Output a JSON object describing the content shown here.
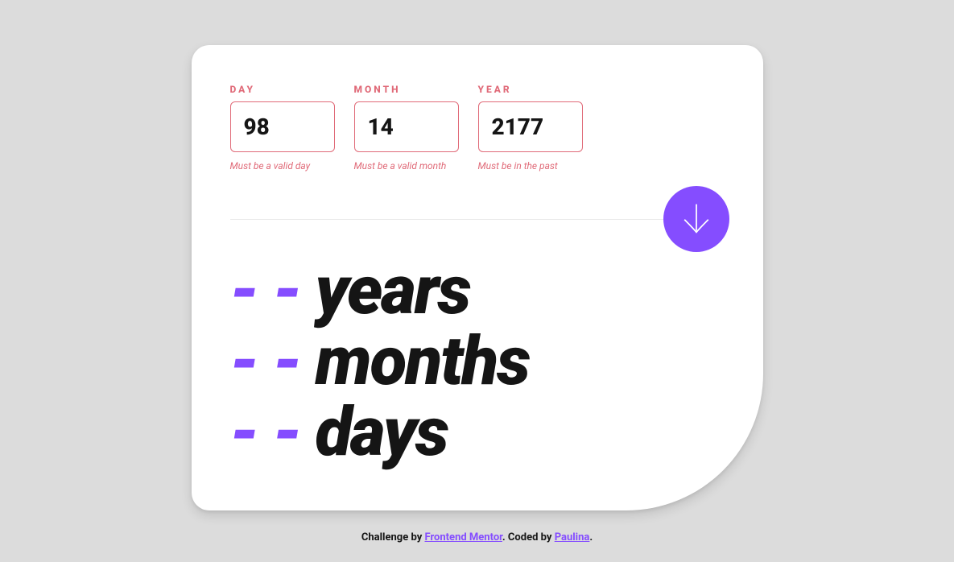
{
  "form": {
    "day": {
      "label": "DAY",
      "value": "98",
      "error": "Must be a valid day"
    },
    "month": {
      "label": "MONTH",
      "value": "14",
      "error": "Must be a valid month"
    },
    "year": {
      "label": "YEAR",
      "value": "2177",
      "error": "Must be in the past"
    }
  },
  "results": {
    "years_value": "- -",
    "years_label": "years",
    "months_value": "- -",
    "months_label": "months",
    "days_value": "- -",
    "days_label": "days"
  },
  "attribution": {
    "prefix": "Challenge by ",
    "link1_text": "Frontend Mentor",
    "mid": ". Coded by ",
    "link2_text": "Paulina",
    "suffix": "."
  },
  "colors": {
    "accent": "#854dff",
    "error": "#e06a78",
    "bg": "#dcdcdc"
  }
}
